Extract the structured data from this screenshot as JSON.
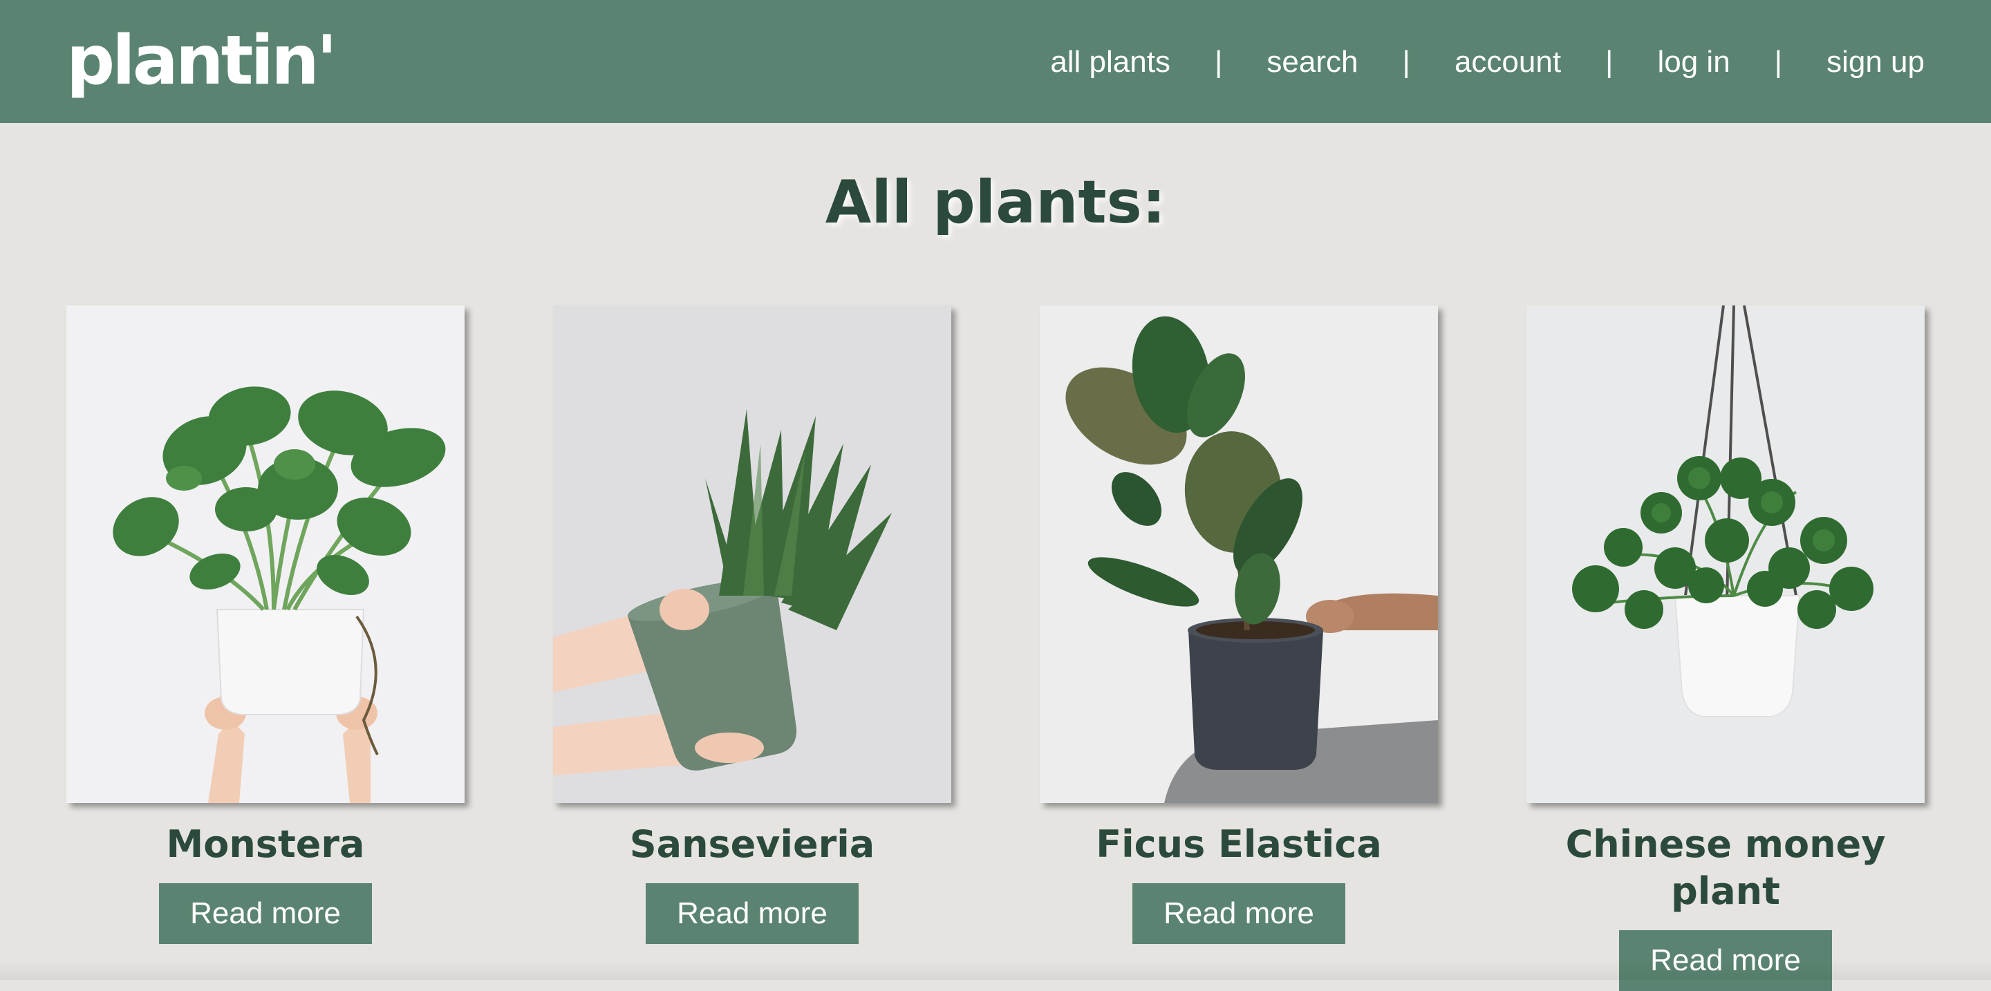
{
  "header": {
    "logo": "plantin'",
    "nav": [
      {
        "label": "all plants"
      },
      {
        "label": "search"
      },
      {
        "label": "account"
      },
      {
        "label": "log in"
      },
      {
        "label": "sign up"
      }
    ],
    "separator": "|"
  },
  "main": {
    "title": "All plants:",
    "plants": [
      {
        "name": "Monstera",
        "button": "Read more"
      },
      {
        "name": "Sansevieria",
        "button": "Read more"
      },
      {
        "name": "Ficus Elastica",
        "button": "Read more"
      },
      {
        "name": "Chinese money plant",
        "button": "Read more"
      }
    ]
  },
  "colors": {
    "header_bg": "#5a8471",
    "page_bg": "#e6e4e0",
    "title_text": "#2b4a3c",
    "button_bg": "#5a8471"
  }
}
